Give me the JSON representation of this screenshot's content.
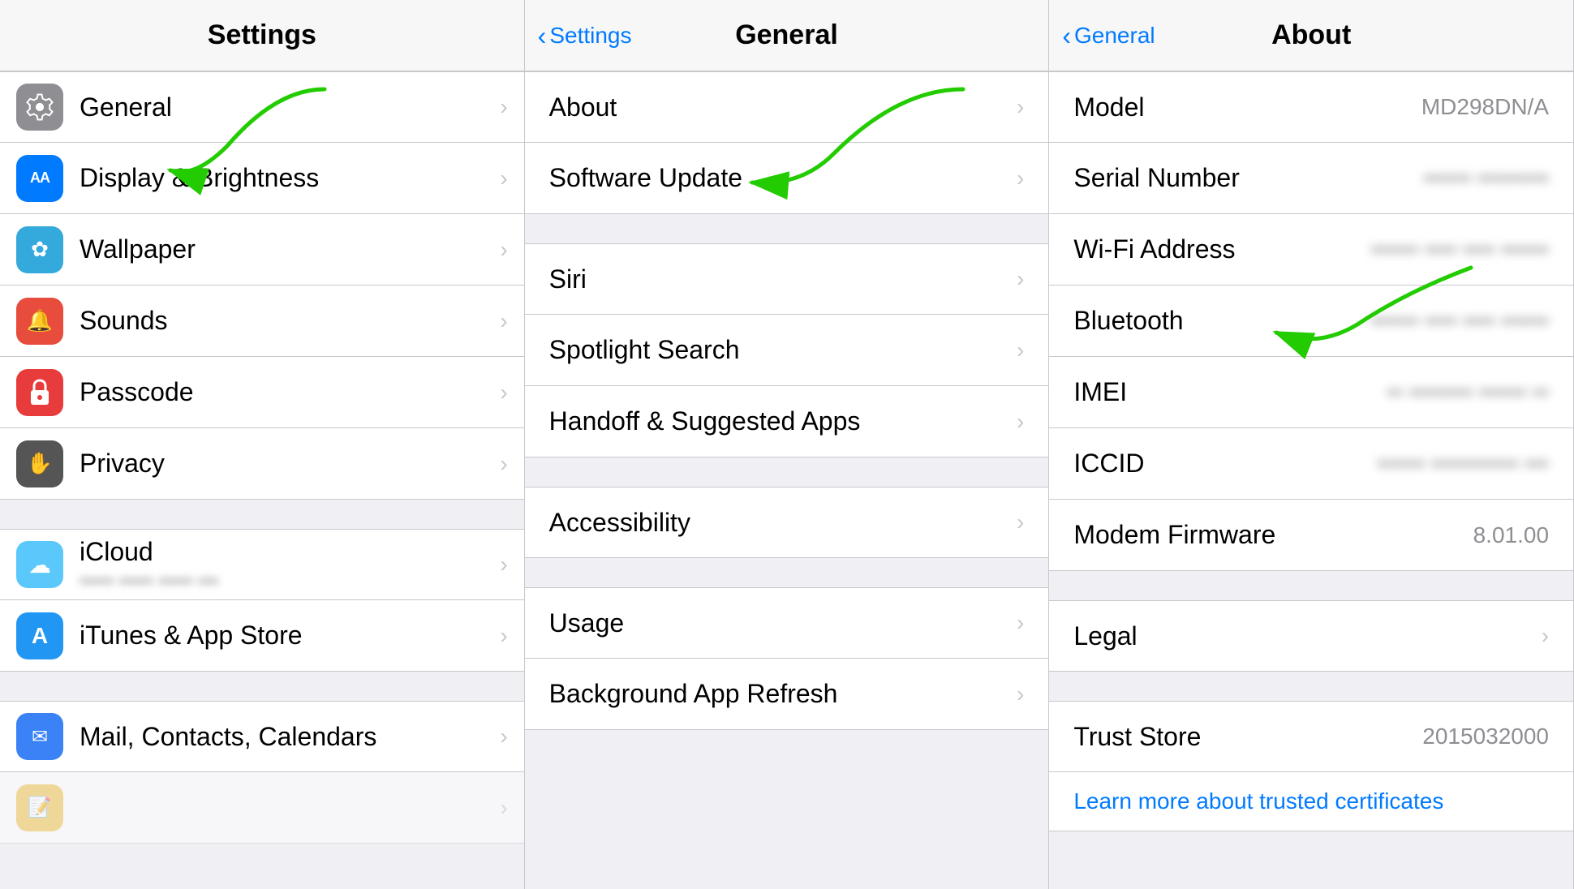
{
  "panels": {
    "settings": {
      "title": "Settings",
      "items": [
        {
          "id": "general",
          "label": "General",
          "icon_color": "icon-gray",
          "icon_char": "⚙",
          "has_chevron": true
        },
        {
          "id": "display",
          "label": "Display & Brightness",
          "icon_color": "icon-blue-aa",
          "icon_char": "AA",
          "icon_text_size": "18px",
          "has_chevron": true
        },
        {
          "id": "wallpaper",
          "label": "Wallpaper",
          "icon_color": "icon-teal",
          "icon_char": "❋",
          "has_chevron": true
        },
        {
          "id": "sounds",
          "label": "Sounds",
          "icon_color": "icon-red",
          "icon_char": "🔊",
          "has_chevron": true
        },
        {
          "id": "passcode",
          "label": "Passcode",
          "icon_color": "icon-pink-red",
          "icon_char": "🔒",
          "has_chevron": true
        },
        {
          "id": "privacy",
          "label": "Privacy",
          "icon_color": "icon-dark",
          "icon_char": "✋",
          "has_chevron": true
        }
      ],
      "items2": [
        {
          "id": "icloud",
          "label": "iCloud",
          "sub": "••••• ••••• ••••• •••",
          "icon_color": "icon-icloud",
          "icon_char": "☁",
          "has_chevron": true
        },
        {
          "id": "itunes",
          "label": "iTunes & App Store",
          "icon_color": "icon-appstore",
          "icon_char": "A",
          "has_chevron": true
        }
      ],
      "items3": [
        {
          "id": "mail",
          "label": "Mail, Contacts, Calendars",
          "icon_color": "icon-mail",
          "icon_char": "✉",
          "has_chevron": true
        },
        {
          "id": "notes",
          "label": "",
          "icon_color": "icon-yellow",
          "icon_char": "📝",
          "has_chevron": true
        }
      ]
    },
    "general": {
      "title": "General",
      "back_label": "Settings",
      "items": [
        {
          "id": "about",
          "label": "About",
          "has_chevron": true
        },
        {
          "id": "software_update",
          "label": "Software Update",
          "has_chevron": true
        }
      ],
      "items2": [
        {
          "id": "siri",
          "label": "Siri",
          "has_chevron": true
        },
        {
          "id": "spotlight",
          "label": "Spotlight Search",
          "has_chevron": true
        },
        {
          "id": "handoff",
          "label": "Handoff & Suggested Apps",
          "has_chevron": true
        }
      ],
      "items3": [
        {
          "id": "accessibility",
          "label": "Accessibility",
          "has_chevron": true
        }
      ],
      "items4": [
        {
          "id": "usage",
          "label": "Usage",
          "has_chevron": true
        },
        {
          "id": "background_refresh",
          "label": "Background App Refresh",
          "has_chevron": true
        }
      ]
    },
    "about": {
      "title": "About",
      "back_label": "General",
      "rows": [
        {
          "id": "model",
          "label": "Model",
          "value": "MD298DN/A",
          "blurred": false,
          "has_chevron": false
        },
        {
          "id": "serial",
          "label": "Serial Number",
          "value": "•••••• •••••••••",
          "blurred": true,
          "has_chevron": false
        },
        {
          "id": "wifi",
          "label": "Wi-Fi Address",
          "value": "•••••• •••• •••• ••••••",
          "blurred": true,
          "has_chevron": false
        },
        {
          "id": "bluetooth",
          "label": "Bluetooth",
          "value": "•••••• •••• •••• ••••••",
          "blurred": true,
          "has_chevron": false
        },
        {
          "id": "imei",
          "label": "IMEI",
          "value": "•• •••••••• •••••• ••",
          "blurred": true,
          "has_chevron": false
        },
        {
          "id": "iccid",
          "label": "ICCID",
          "value": "•••••• ••••••••••• •••",
          "blurred": true,
          "has_chevron": false
        },
        {
          "id": "modem",
          "label": "Modem Firmware",
          "value": "8.01.00",
          "blurred": false,
          "has_chevron": false
        }
      ],
      "rows2": [
        {
          "id": "legal",
          "label": "Legal",
          "value": "",
          "blurred": false,
          "has_chevron": true
        }
      ],
      "rows3": [
        {
          "id": "trust",
          "label": "Trust Store",
          "value": "2015032000",
          "blurred": false,
          "has_chevron": false
        }
      ],
      "trust_link": "Learn more about trusted certificates"
    }
  },
  "arrows": {
    "arrow1_desc": "Green arrow pointing to General in Settings panel",
    "arrow2_desc": "Green arrow pointing to About in General panel",
    "arrow3_desc": "Green arrow pointing to IMEI in About panel"
  }
}
